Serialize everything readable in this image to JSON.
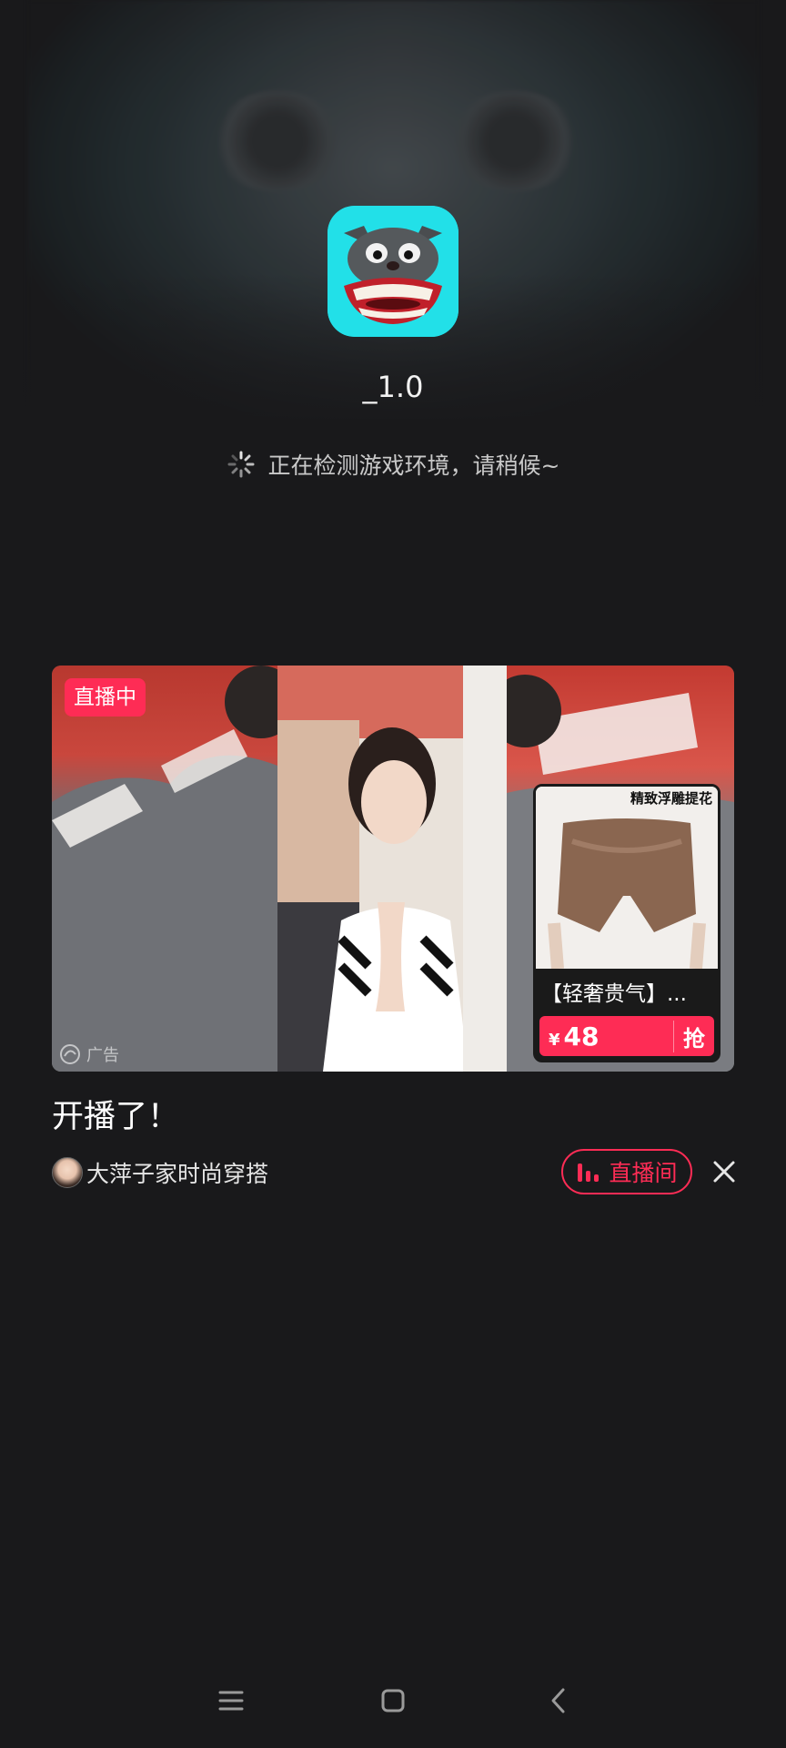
{
  "app": {
    "version_label": "_1.0",
    "status_text": "正在检测游戏环境，请稍候~"
  },
  "ad": {
    "live_badge": "直播中",
    "ad_mark": "广告",
    "product": {
      "tag": "精致浮雕提花",
      "title": "【轻奢贵气】...",
      "currency": "¥",
      "price": "48",
      "grab_label": "抢"
    },
    "title": "开播了！",
    "author_name": "大萍子家时尚穿搭",
    "live_room_button": "直播间"
  },
  "colors": {
    "accent": "#fe2c55",
    "app_icon_bg": "#22e0e8",
    "background": "#19191b"
  },
  "icons": {
    "spinner": "loading-spinner-icon",
    "close": "close-icon",
    "live_bars": "live-bars-icon",
    "nav_menu": "menu-icon",
    "nav_home": "home-icon",
    "nav_back": "back-icon"
  }
}
